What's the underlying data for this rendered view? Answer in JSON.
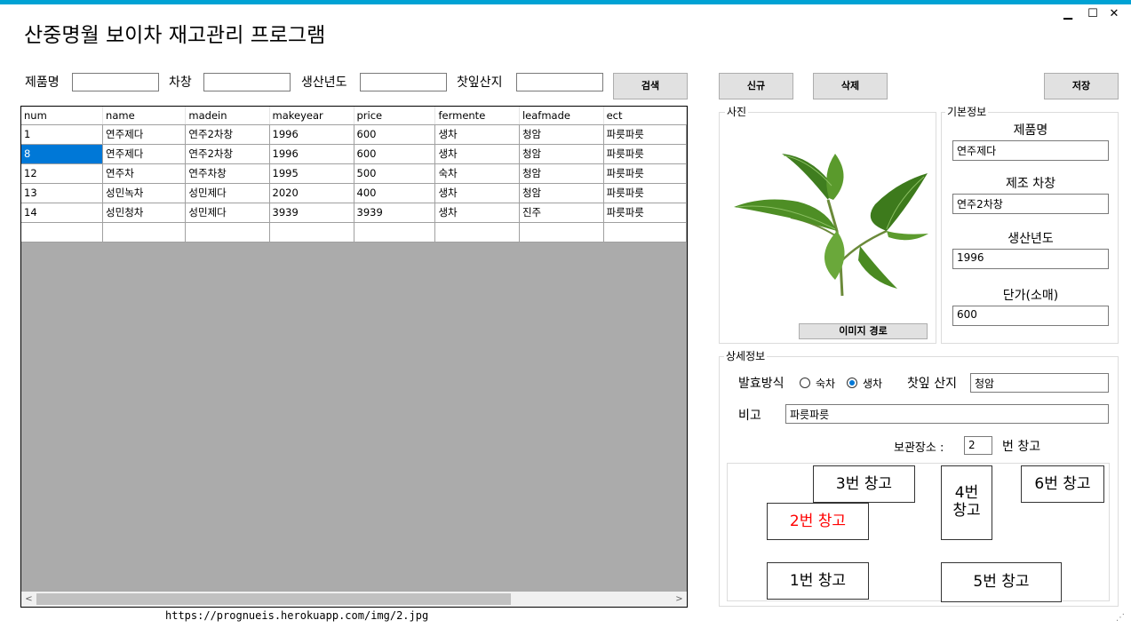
{
  "window": {
    "title": "산중명월 보이차 재고관리 프로그램",
    "min_icon": "minimize-icon",
    "max_icon": "maximize-icon",
    "close_icon": "close-icon",
    "min_glyph": "▁",
    "max_glyph": "☐",
    "close_glyph": "✕"
  },
  "search": {
    "product_label": "제품명",
    "factory_label": "차창",
    "year_label": "생산년도",
    "origin_label": "찻잎산지",
    "product_value": "",
    "factory_value": "",
    "year_value": "",
    "origin_value": "",
    "search_button": "검색"
  },
  "toolbar": {
    "new_button": "신규",
    "delete_button": "삭제",
    "save_button": "저장"
  },
  "grid": {
    "columns": [
      "num",
      "name",
      "madein",
      "makeyear",
      "price",
      "fermente",
      "leafmade",
      "ect"
    ],
    "rows": [
      [
        "1",
        "연주제다",
        "연주2차창",
        "1996",
        "600",
        "생차",
        "청암",
        "파릇파릇"
      ],
      [
        "8",
        "연주제다",
        "연주2차창",
        "1996",
        "600",
        "생차",
        "청암",
        "파릇파릇"
      ],
      [
        "12",
        "연주차",
        "연주차창",
        "1995",
        "500",
        "숙차",
        "청암",
        "파릇파릇"
      ],
      [
        "13",
        "성민녹차",
        "성민제다",
        "2020",
        "400",
        "생차",
        "청암",
        "파릇파릇"
      ],
      [
        "14",
        "성민청차",
        "성민제다",
        "3939",
        "3939",
        "생차",
        "진주",
        "파릇파릇"
      ],
      [
        "",
        "",
        "",
        "",
        "",
        "",
        "",
        ""
      ]
    ],
    "selected_row": 1,
    "scroll_left": "<",
    "scroll_right": ">"
  },
  "image_path": "https://prognueis.herokuapp.com/img/2.jpg",
  "photo": {
    "group_title": "사진",
    "path_button": "이미지 경로"
  },
  "basic": {
    "group_title": "기본정보",
    "product_label": "제품명",
    "product_value": "연주제다",
    "factory_label": "제조 차창",
    "factory_value": "연주2차창",
    "year_label": "생산년도",
    "year_value": "1996",
    "price_label": "단가(소매)",
    "price_value": "600"
  },
  "detail": {
    "group_title": "상세정보",
    "ferment_label": "발효방식",
    "ripe_option": "숙차",
    "raw_option": "생차",
    "selected_ferment": "생차",
    "origin_label": "찻잎 산지",
    "origin_value": "청암",
    "note_label": "비고",
    "note_value": "파릇파릇",
    "storage_label": "보관장소 :",
    "storage_value": "2",
    "storage_suffix": "번 창고",
    "selected_color": "#ff0000"
  },
  "warehouses": {
    "w1": "1번 창고",
    "w2": "2번 창고",
    "w3": "3번 창고",
    "w4_line1": "4번",
    "w4_line2": "창고",
    "w5": "5번 창고",
    "w6": "6번 창고"
  },
  "accent_color": "#00a2d4",
  "selection_color": "#0078d7"
}
